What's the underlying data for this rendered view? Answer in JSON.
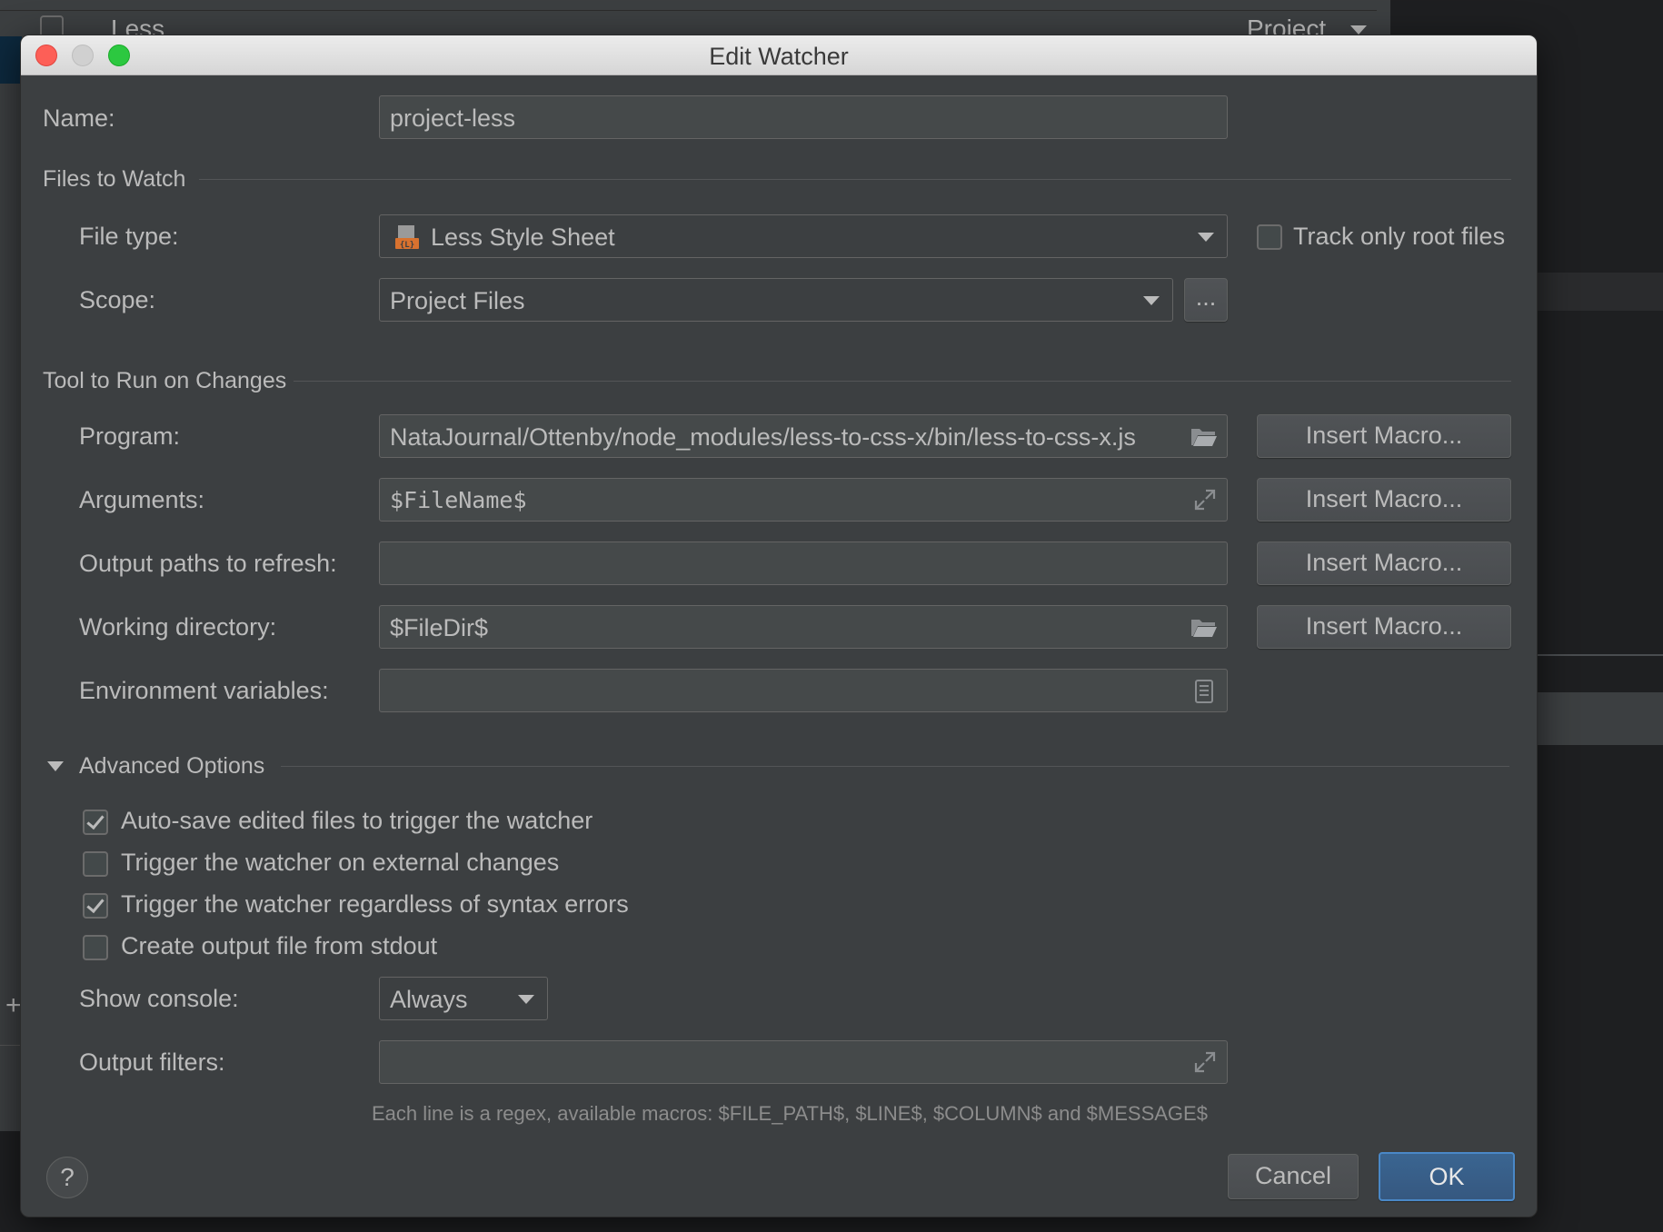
{
  "background": {
    "row_label": "Less",
    "row_scope": "Project"
  },
  "dialog": {
    "title": "Edit Watcher",
    "name_label": "Name:",
    "name_value": "project-less",
    "files_section": "Files to Watch",
    "file_type_label": "File type:",
    "file_type_value": "Less Style Sheet",
    "track_root_label": "Track only root files",
    "track_root_checked": false,
    "scope_label": "Scope:",
    "scope_value": "Project Files",
    "scope_more": "...",
    "tool_section": "Tool to Run on Changes",
    "program_label": "Program:",
    "program_value": "NataJournal/Ottenby/node_modules/less-to-css-x/bin/less-to-css-x.js",
    "arguments_label": "Arguments:",
    "arguments_value": "$FileName$",
    "output_paths_label": "Output paths to refresh:",
    "output_paths_value": "",
    "working_dir_label": "Working directory:",
    "working_dir_value": "$FileDir$",
    "env_label": "Environment variables:",
    "env_value": "",
    "insert_macro": "Insert Macro...",
    "advanced_section": "Advanced Options",
    "options": [
      {
        "label": "Auto-save edited files to trigger the watcher",
        "checked": true
      },
      {
        "label": "Trigger the watcher on external changes",
        "checked": false
      },
      {
        "label": "Trigger the watcher regardless of syntax errors",
        "checked": true
      },
      {
        "label": "Create output file from stdout",
        "checked": false
      }
    ],
    "show_console_label": "Show console:",
    "show_console_value": "Always",
    "output_filters_label": "Output filters:",
    "output_filters_value": "",
    "output_filters_hint": "Each line is a regex, available macros: $FILE_PATH$, $LINE$, $COLUMN$ and $MESSAGE$",
    "help": "?",
    "cancel": "Cancel",
    "ok": "OK"
  },
  "colors": {
    "dialog_bg": "#3c3f41",
    "field_bg": "#45494a",
    "accent": "#4a88c7",
    "less_icon": "#d8722f"
  },
  "icons": [
    "close-icon",
    "minimize-icon",
    "maximize-icon",
    "less-file-icon",
    "folder-icon",
    "expand-icon",
    "list-icon",
    "disclosure-triangle-icon",
    "help-icon"
  ]
}
